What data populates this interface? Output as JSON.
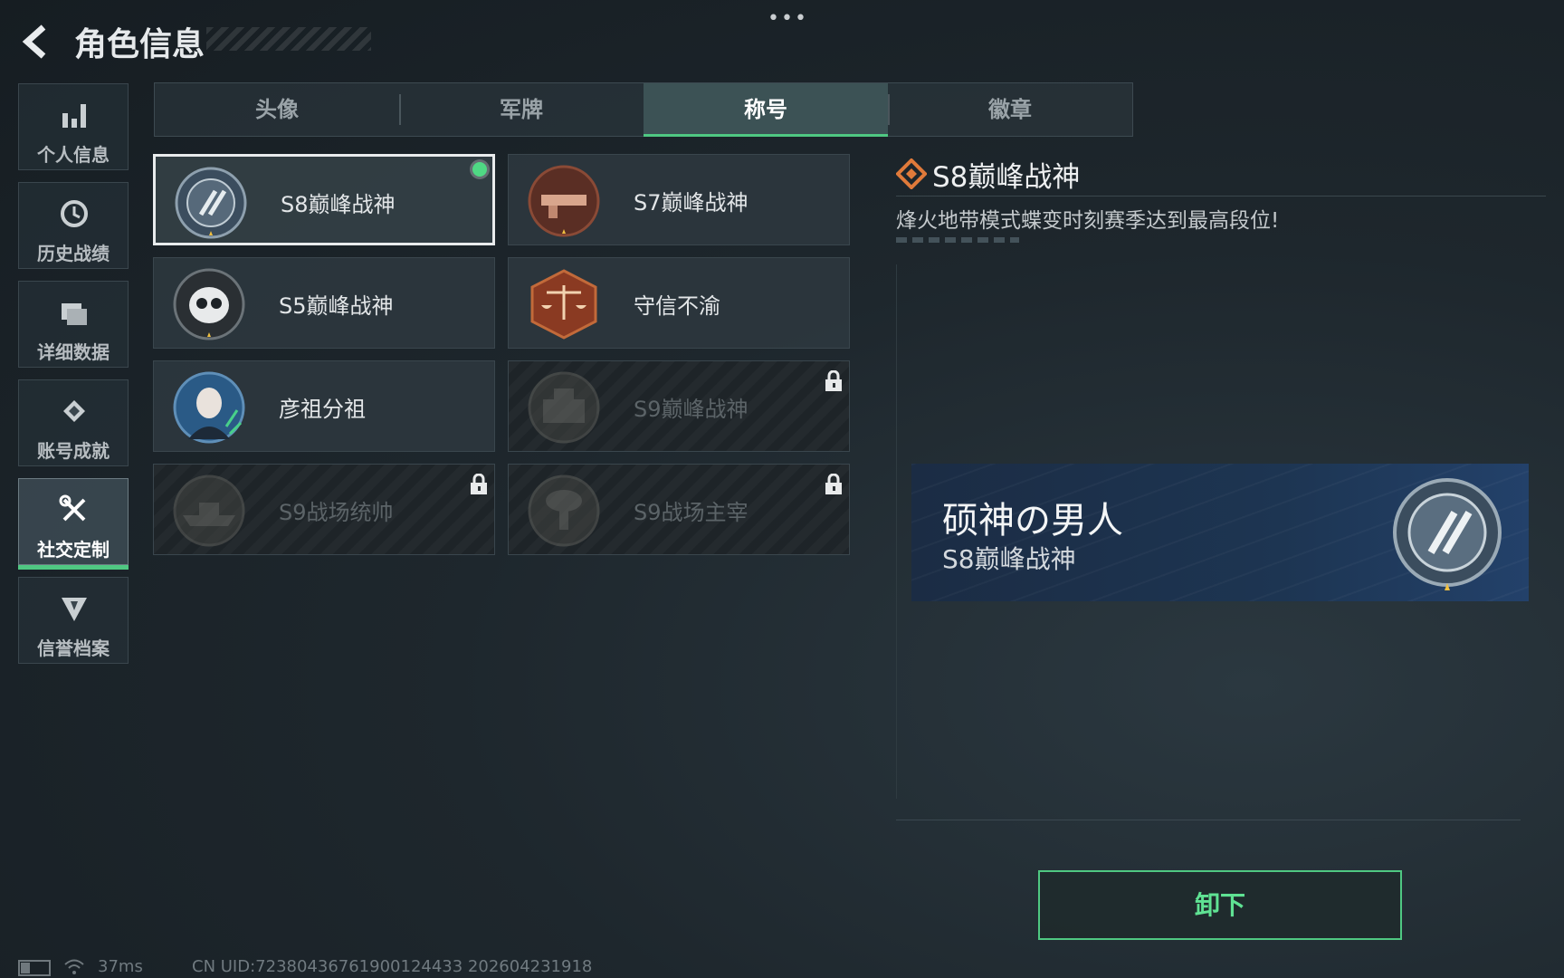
{
  "header": {
    "title": "角色信息"
  },
  "sidebar": {
    "items": [
      {
        "label": "个人信息",
        "icon": "bar-chart-icon"
      },
      {
        "label": "历史战绩",
        "icon": "clock-icon"
      },
      {
        "label": "详细数据",
        "icon": "folder-icon"
      },
      {
        "label": "账号成就",
        "icon": "achievement-icon"
      },
      {
        "label": "社交定制",
        "icon": "tools-icon",
        "active": true
      },
      {
        "label": "信誉档案",
        "icon": "credit-shield-icon"
      }
    ]
  },
  "tabs": [
    {
      "label": "头像"
    },
    {
      "label": "军牌"
    },
    {
      "label": "称号",
      "active": true
    },
    {
      "label": "徽章"
    }
  ],
  "titles": [
    {
      "name": "S8巅峰战神",
      "emblem": "s8-wreath-emblem",
      "selected": true,
      "equipped": true
    },
    {
      "name": "S7巅峰战神",
      "emblem": "s7-weapon-emblem"
    },
    {
      "name": "S5巅峰战神",
      "emblem": "s5-skull-emblem"
    },
    {
      "name": "守信不渝",
      "emblem": "scales-emblem"
    },
    {
      "name": "彦祖分祖",
      "emblem": "portrait-emblem"
    },
    {
      "name": "S9巅峰战神",
      "emblem": "s9-fortress-emblem",
      "locked": true
    },
    {
      "name": "S9战场统帅",
      "emblem": "s9-warship-emblem",
      "locked": true
    },
    {
      "name": "S9战场主宰",
      "emblem": "s9-mushroom-cloud-emblem",
      "locked": true
    }
  ],
  "detail": {
    "name": "S8巅峰战神",
    "description": "烽火地带模式蝶变时刻赛季达到最高段位!",
    "banner_title": "硕神の男人",
    "banner_subtitle": "S8巅峰战神",
    "button_label": "卸下"
  },
  "status": {
    "ping": "37ms",
    "uid": "CN UID:72380436761900124433 202604231918"
  },
  "colors": {
    "accent": "#4fc882",
    "diamond": "#e07a3a",
    "banner": "#1d3552"
  }
}
